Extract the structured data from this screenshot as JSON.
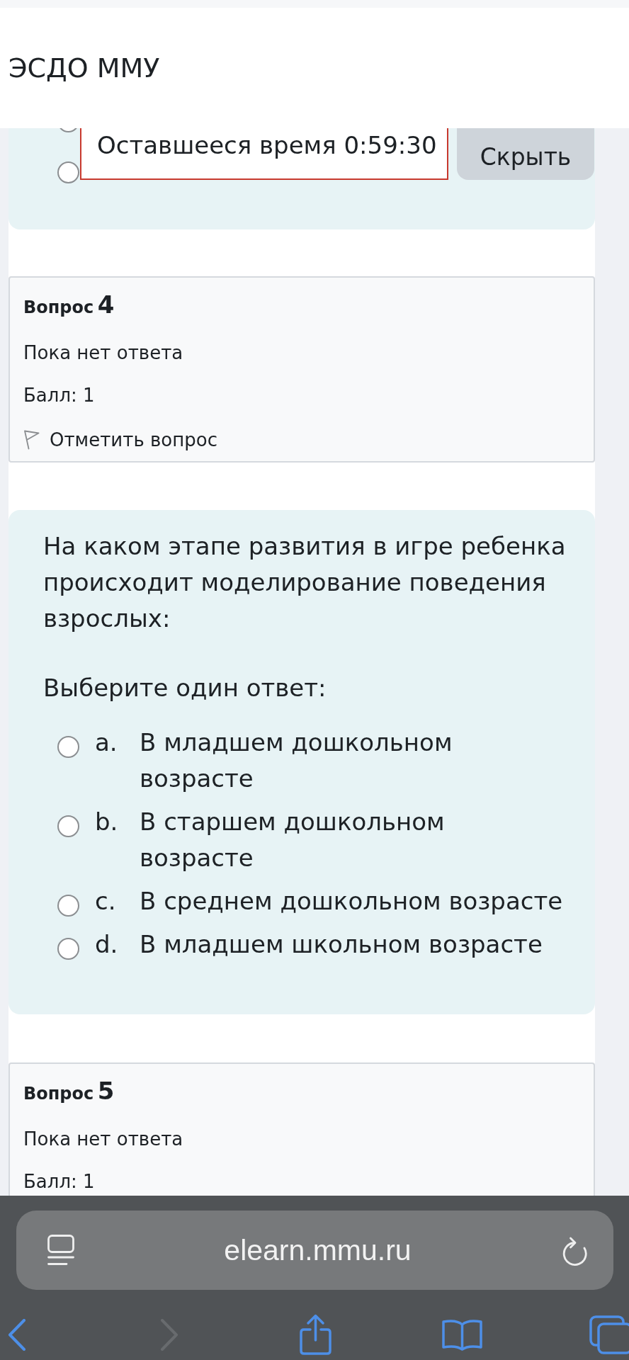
{
  "header": {
    "title": "ЭСДО ММУ"
  },
  "previous_question": {
    "answers": [
      {
        "selected": false
      },
      {
        "selected": false
      }
    ]
  },
  "timer": {
    "text": "Оставшееся время 0:59:30"
  },
  "hide_button": {
    "label": "Скрыть"
  },
  "questions": [
    {
      "kind": "info",
      "title": "Вопрос",
      "number": "4",
      "status": "Пока нет ответа",
      "grade": "Балл: 1",
      "flag": "Отметить вопрос"
    },
    {
      "kind": "content",
      "text": "На каком этапе развития в игре ребенка происходит моделирование поведения взрослых:",
      "prompt": "Выберите один ответ:",
      "answers": [
        {
          "letter": "a.",
          "text": "В младшем дошкольном возрасте",
          "selected": false
        },
        {
          "letter": "b.",
          "text": "В старшем дошкольном возрасте",
          "selected": false
        },
        {
          "letter": "c.",
          "text": "В среднем дошкольном возрасте",
          "selected": false
        },
        {
          "letter": "d.",
          "text": "В младшем школьном возрасте",
          "selected": false
        }
      ]
    },
    {
      "kind": "info",
      "title": "Вопрос",
      "number": "5",
      "status": "Пока нет ответа",
      "grade": "Балл: 1"
    }
  ],
  "browser": {
    "url": "elearn.mmu.ru",
    "toolbar": [
      {
        "kind": "back",
        "disabled": false
      },
      {
        "kind": "forward",
        "disabled": true
      },
      {
        "kind": "share",
        "disabled": false
      },
      {
        "kind": "bookmarks",
        "disabled": false
      },
      {
        "kind": "tabs",
        "disabled": false
      }
    ]
  }
}
